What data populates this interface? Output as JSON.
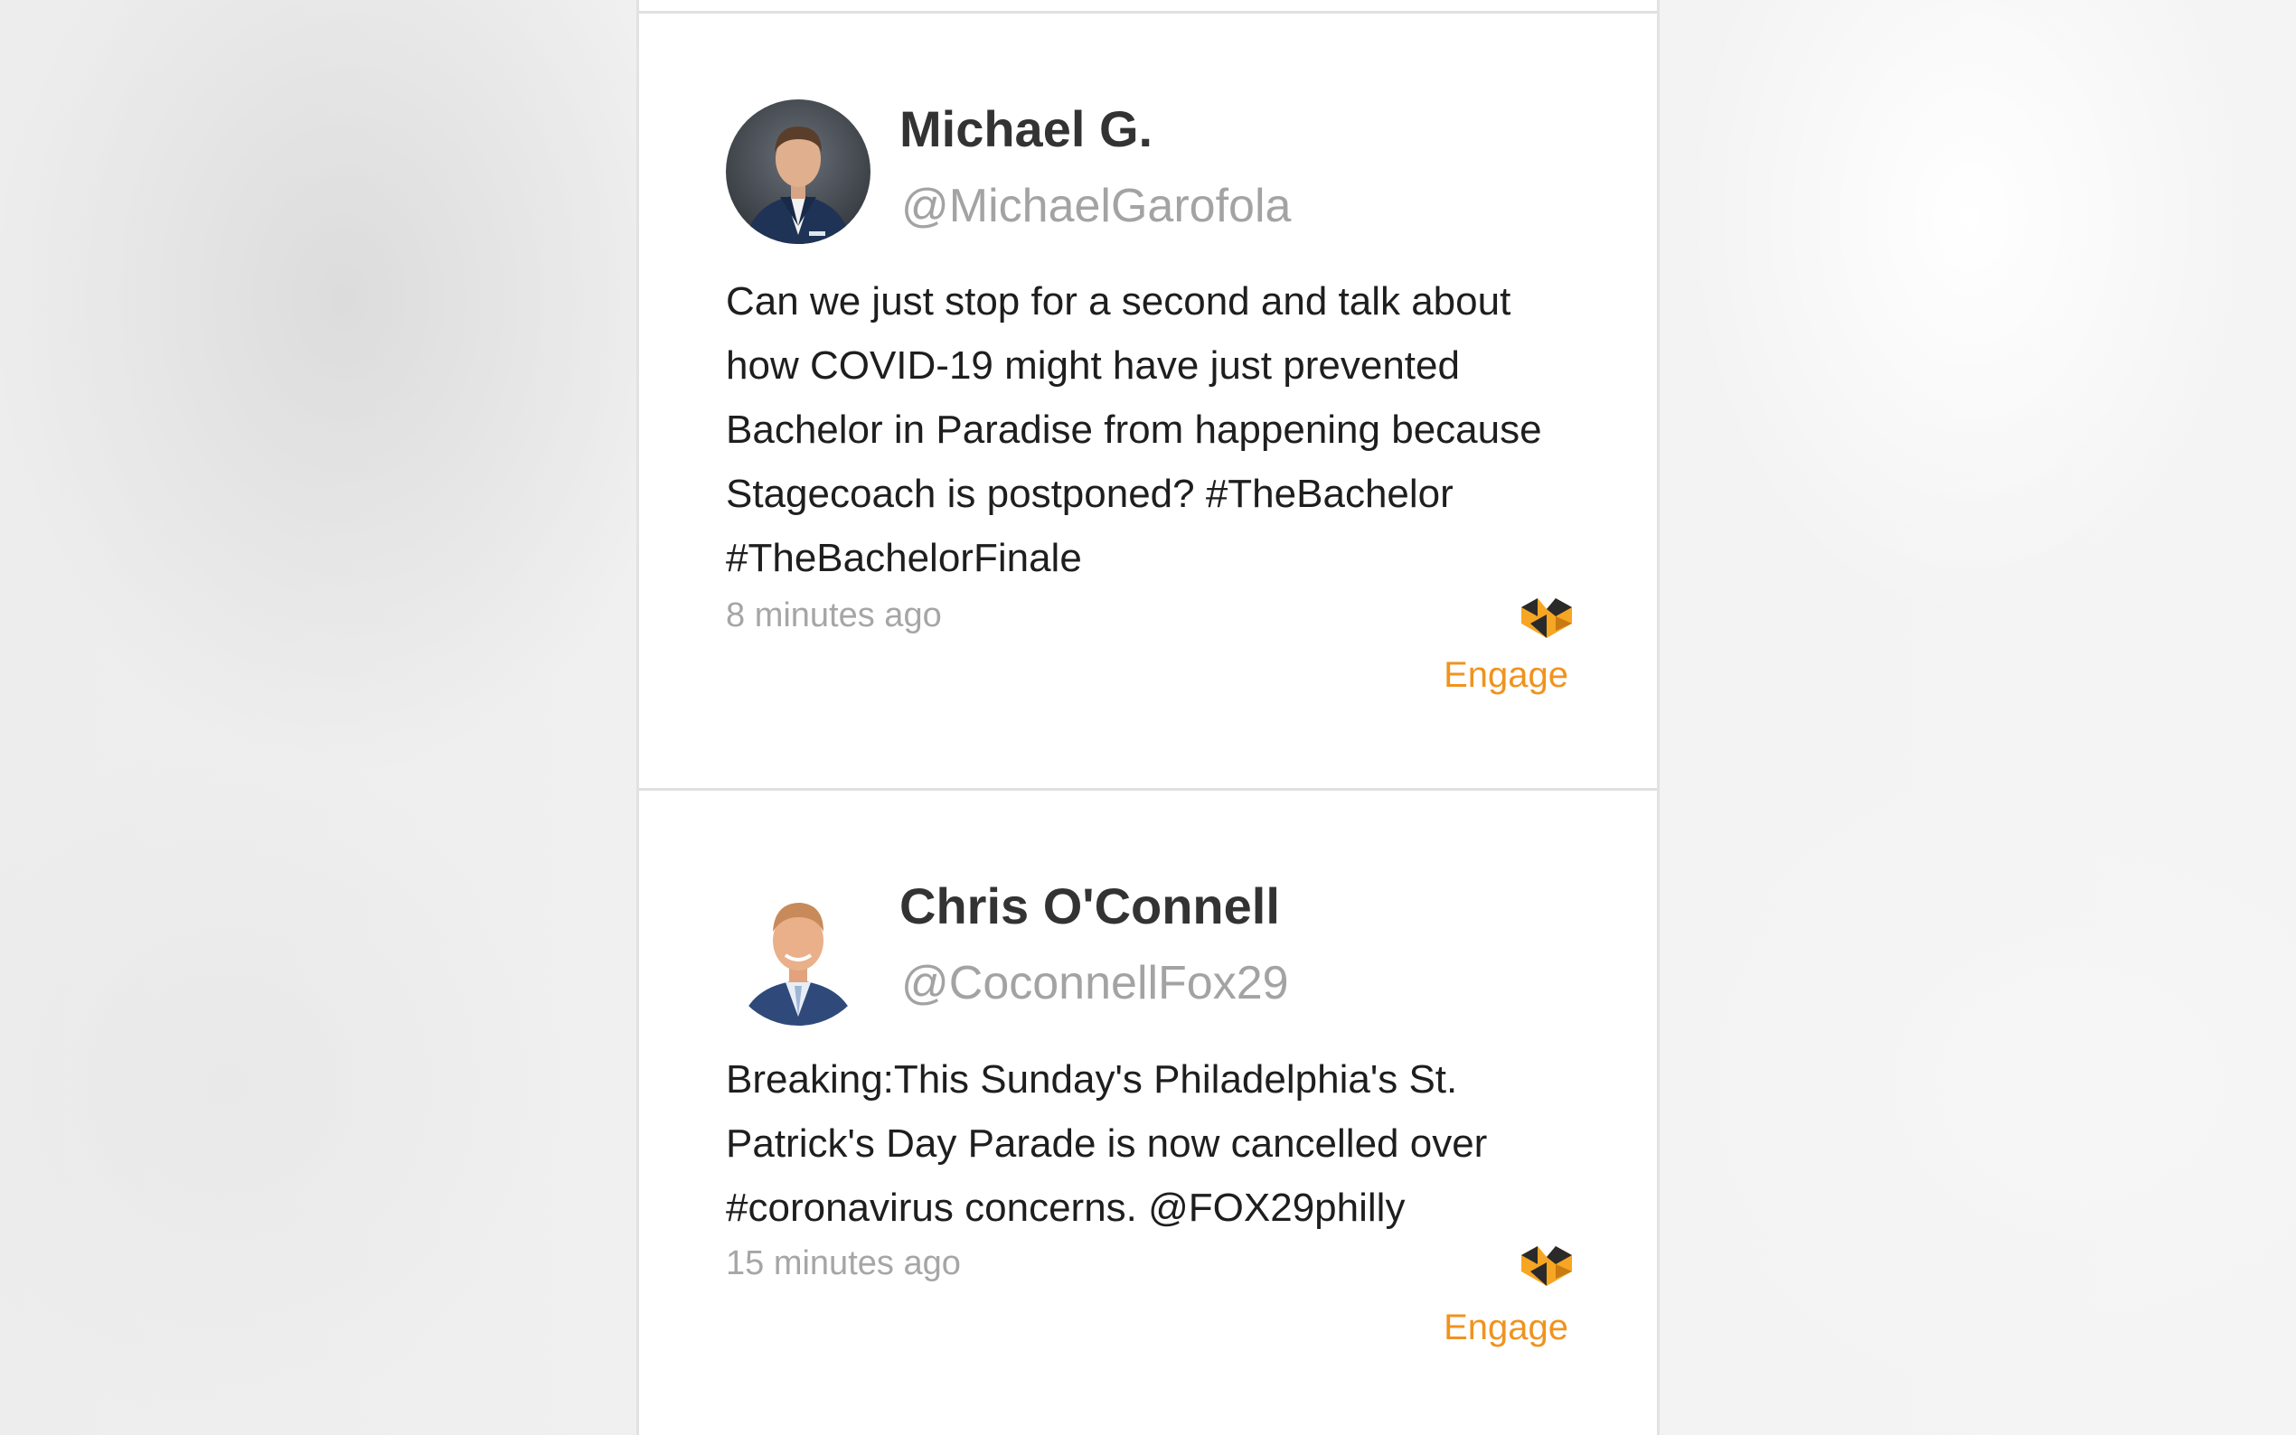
{
  "posts": [
    {
      "name": "Michael G.",
      "handle": "@MichaelGarofola",
      "text": "Can we just stop for a second and talk about how COVID-19 might have just prevented Bachelor in Paradise from happening because Stagecoach is postponed? #TheBachelor #TheBachelorFinale",
      "time": "8 minutes ago",
      "engage_label": "Engage",
      "avatar_icon": "avatar-photo-man-navy-suit",
      "brand_icon": "engage-logo-icon"
    },
    {
      "name": "Chris O'Connell",
      "handle": "@CoconnellFox29",
      "text": "Breaking:This Sunday's Philadelphia's St. Patrick's Day Parade is now cancelled over #coronavirus concerns. @FOX29philly",
      "time": "15 minutes ago",
      "engage_label": "Engage",
      "avatar_icon": "avatar-photo-man-blue-suit",
      "brand_icon": "engage-logo-icon"
    }
  ],
  "colors": {
    "accent": "#f0931e",
    "name_text": "#333333",
    "handle_text": "#a3a3a3",
    "body_text": "#1e1e1e",
    "time_text": "#a6a6a6",
    "divider": "#e0e0e0"
  }
}
